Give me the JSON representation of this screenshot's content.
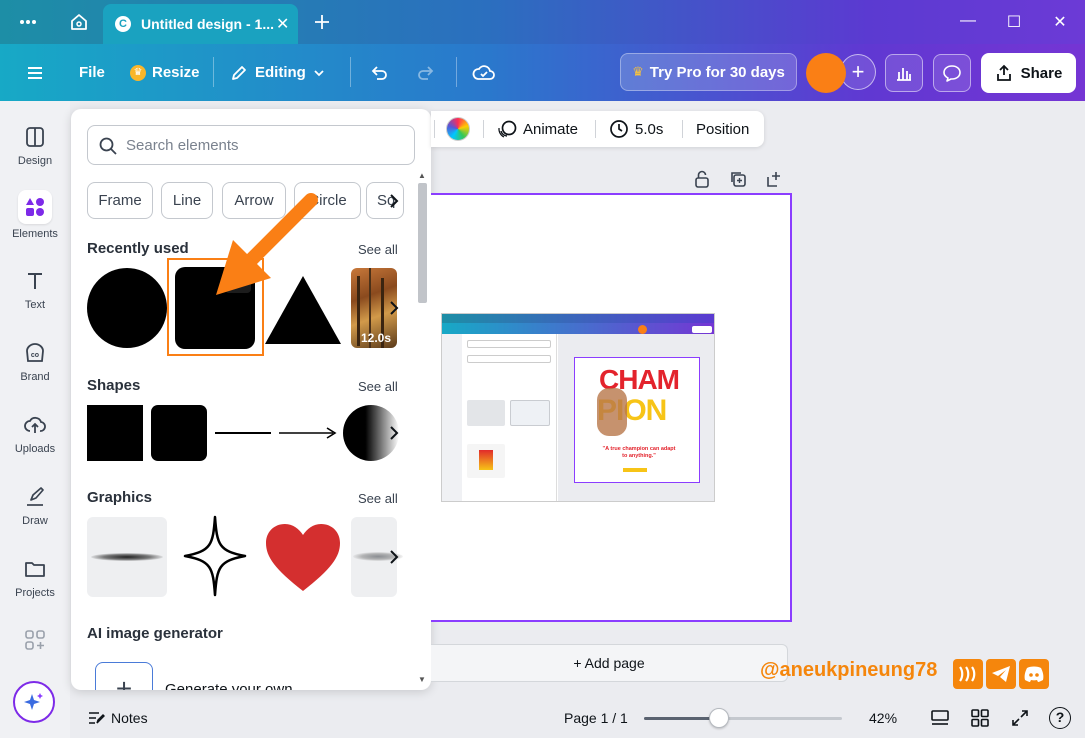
{
  "titlebar": {
    "tab_title": "Untitled design - 1...",
    "tab_logo": "C",
    "icons": [
      "more-icon",
      "home-icon",
      "close-icon",
      "new-tab-plus-icon",
      "minimize-icon",
      "maximize-icon",
      "window-close-icon"
    ]
  },
  "toolbar": {
    "file_label": "File",
    "resize_label": "Resize",
    "editing_label": "Editing",
    "try_pro_label": "Try Pro for 30 days",
    "share_label": "Share",
    "plus_label": "+"
  },
  "rail": {
    "items": [
      {
        "label": "Design",
        "icon": "design-icon"
      },
      {
        "label": "Elements",
        "icon": "elements-icon"
      },
      {
        "label": "Text",
        "icon": "text-icon"
      },
      {
        "label": "Brand",
        "icon": "brand-icon"
      },
      {
        "label": "Uploads",
        "icon": "uploads-icon"
      },
      {
        "label": "Draw",
        "icon": "draw-icon"
      },
      {
        "label": "Projects",
        "icon": "projects-icon"
      }
    ]
  },
  "panel": {
    "search_placeholder": "Search elements",
    "chips": [
      "Frame",
      "Line",
      "Arrow",
      "Circle",
      "Sq"
    ],
    "recently_used": {
      "title": "Recently used",
      "see_all": "See all",
      "video_duration": "12.0s",
      "more_dots": "···"
    },
    "shapes": {
      "title": "Shapes",
      "see_all": "See all"
    },
    "graphics": {
      "title": "Graphics",
      "see_all": "See all"
    },
    "ai": {
      "title": "AI image generator",
      "generate_label": "Generate your own",
      "plus": "+"
    }
  },
  "context_bar": {
    "animate_label": "Animate",
    "duration_label": "5.0s",
    "position_label": "Position"
  },
  "canvas": {
    "add_page_label": "+ Add page",
    "embed": {
      "headline_top": "CHAM",
      "headline_bottom": "PION",
      "quote": "\"A true champion can adapt to anything.\""
    }
  },
  "bottom": {
    "notes_label": "Notes",
    "page_label": "Page 1 / 1",
    "zoom_label": "42%",
    "zoom_level": 0.38,
    "help_label": "?"
  },
  "watermark": {
    "handle": "@aneukpineung78"
  },
  "colors": {
    "accent_purple": "#8b3dff",
    "highlight_orange": "#fa7f15",
    "avatar": "#fa7f15"
  }
}
